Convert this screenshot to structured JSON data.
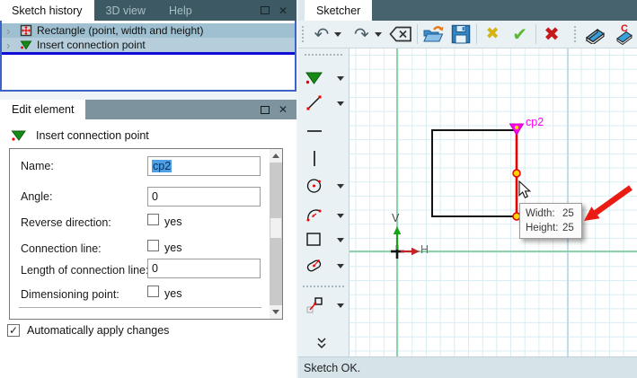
{
  "icons": {
    "close_glyph": "✕",
    "chevron_glyph": "›",
    "check_glyph": "✓"
  },
  "sketch_history": {
    "tabs": [
      {
        "label": "Sketch history"
      },
      {
        "label": "3D view"
      },
      {
        "label": "Help"
      }
    ],
    "items": [
      {
        "label": "Rectangle (point, width and height)"
      },
      {
        "label": "Insert connection point"
      }
    ]
  },
  "edit_element": {
    "tab": "Edit element",
    "header": "Insert connection point",
    "fields": {
      "name": {
        "label": "Name:",
        "value": "cp2"
      },
      "angle": {
        "label": "Angle:",
        "value": "0"
      },
      "reverse": {
        "label": "Reverse direction:",
        "suffix": "yes",
        "checked": false
      },
      "connection_line": {
        "label": "Connection line:",
        "suffix": "yes",
        "checked": false
      },
      "length": {
        "label": "Length of connection line:",
        "value": "0"
      },
      "dimensioning": {
        "label": "Dimensioning point:",
        "suffix": "yes",
        "checked": false
      }
    },
    "auto_apply_label": "Automatically apply changes"
  },
  "sketcher": {
    "tab": "Sketcher",
    "toolbar": {
      "undo_glyph": "↶",
      "redo_glyph": "↷",
      "cancel_glyph": "✖",
      "apply_glyph": "✔",
      "close_glyph": "✖",
      "erase_all_letter": "C"
    },
    "status": "Sketch OK.",
    "canvas": {
      "point_label": "cp2",
      "axis_v": "V",
      "axis_h": "H",
      "tooltip": {
        "width_label": "Width:",
        "width_value": "25",
        "height_label": "Height:",
        "height_value": "25"
      }
    }
  },
  "colors": {
    "selection_red": "#e60000",
    "point_yellow": "#ffd400",
    "cp_magenta": "#ff00f0",
    "axis_green": "#8ed1ab",
    "callout_arrow_red": "#ea1b12",
    "insert_indicator_blue": "#0d0dd6"
  }
}
